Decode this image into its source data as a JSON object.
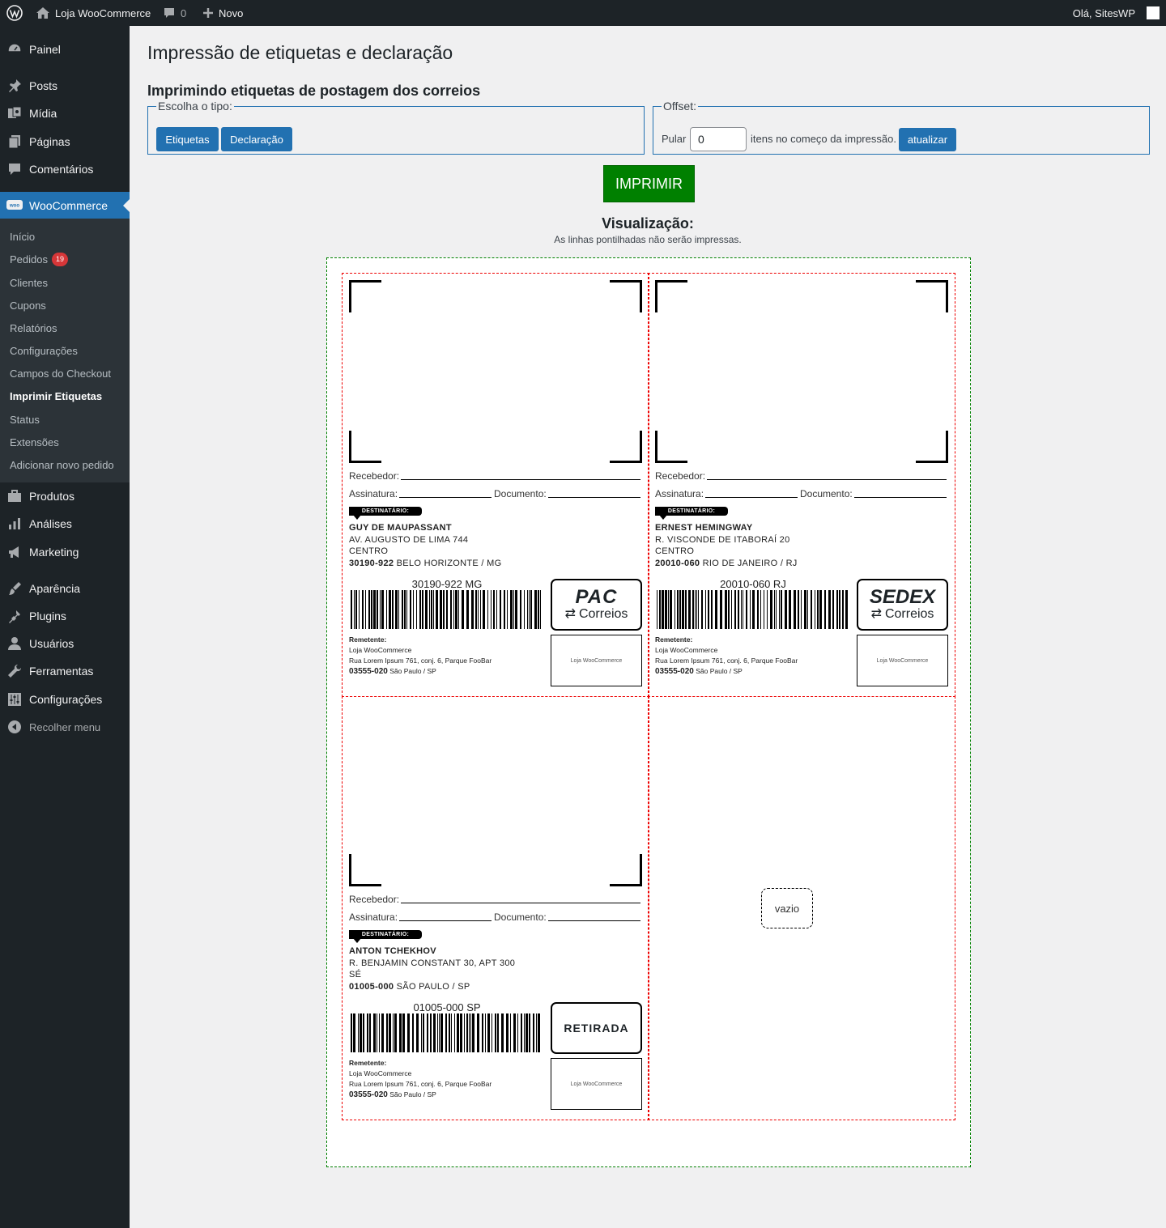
{
  "adminbar": {
    "site_name": "Loja WooCommerce",
    "comments_count": "0",
    "new_label": "Novo",
    "greeting": "Olá, SitesWP"
  },
  "sidebar": {
    "items": [
      {
        "label": "Painel",
        "icon": "dashboard-icon"
      },
      {
        "label": "Posts",
        "icon": "pin-icon"
      },
      {
        "label": "Mídia",
        "icon": "media-icon"
      },
      {
        "label": "Páginas",
        "icon": "pages-icon"
      },
      {
        "label": "Comentários",
        "icon": "comments-icon"
      },
      {
        "label": "WooCommerce",
        "icon": "woo-icon"
      },
      {
        "label": "Produtos",
        "icon": "products-icon"
      },
      {
        "label": "Análises",
        "icon": "analytics-icon"
      },
      {
        "label": "Marketing",
        "icon": "megaphone-icon"
      },
      {
        "label": "Aparência",
        "icon": "appearance-icon"
      },
      {
        "label": "Plugins",
        "icon": "plugin-icon"
      },
      {
        "label": "Usuários",
        "icon": "users-icon"
      },
      {
        "label": "Ferramentas",
        "icon": "tools-icon"
      },
      {
        "label": "Configurações",
        "icon": "settings-icon"
      },
      {
        "label": "Recolher menu",
        "icon": "collapse-icon"
      }
    ],
    "submenu": [
      "Início",
      "Pedidos",
      "Clientes",
      "Cupons",
      "Relatórios",
      "Configurações",
      "Campos do Checkout",
      "Imprimir Etiquetas",
      "Status",
      "Extensões",
      "Adicionar novo pedido"
    ],
    "orders_badge": "19"
  },
  "page": {
    "title": "Impressão de etiquetas e declaração",
    "subtitle": "Imprimindo etiquetas de postagem dos correios",
    "type_legend": "Escolha o tipo:",
    "btn_labels": "Etiquetas",
    "btn_declaration": "Declaração",
    "offset_legend": "Offset:",
    "skip_label": "Pular",
    "offset_value": "0",
    "offset_suffix": "itens no começo da impressão.",
    "update_button": "atualizar",
    "print_button": "IMPRIMIR",
    "preview_title": "Visualização:",
    "preview_note": "As linhas pontilhadas não serão impressas."
  },
  "label_fields": {
    "receiver": "Recebedor:",
    "signature": "Assinatura:",
    "document": "Documento:",
    "dest_tag": "DESTINATÁRIO:",
    "sender_title": "Remetente:"
  },
  "sender": {
    "name": "Loja WooCommerce",
    "street": "Rua Lorem Ipsum 761, conj. 6, Parque FooBar",
    "cep": "03555-020",
    "city": "São Paulo / SP",
    "logo_text": "Loja WooCommerce"
  },
  "labels": [
    {
      "name": "GUY DE MAUPASSANT",
      "street": "AV. AUGUSTO DE LIMA 744",
      "district": "CENTRO",
      "cep": "30190-922",
      "city": "BELO HORIZONTE / MG",
      "barcode_text": "30190-922 MG",
      "service": "PAC",
      "service_sub": "Correios"
    },
    {
      "name": "ERNEST HEMINGWAY",
      "street": "R. VISCONDE DE ITABORAÍ 20",
      "district": "CENTRO",
      "cep": "20010-060",
      "city": "RIO DE JANEIRO / RJ",
      "barcode_text": "20010-060 RJ",
      "service": "SEDEX",
      "service_sub": "Correios"
    },
    {
      "name": "ANTON TCHEKHOV",
      "street": "R. BENJAMIN CONSTANT 30, APT 300",
      "district": "SÉ",
      "cep": "01005-000",
      "city": "SÃO PAULO / SP",
      "barcode_text": "01005-000 SP",
      "service": "RETIRADA"
    }
  ],
  "empty_label": "vazio",
  "colors": {
    "accent": "#2271b1",
    "print_green": "#008000",
    "sidebar": "#1d2327",
    "badge": "#d63638"
  }
}
